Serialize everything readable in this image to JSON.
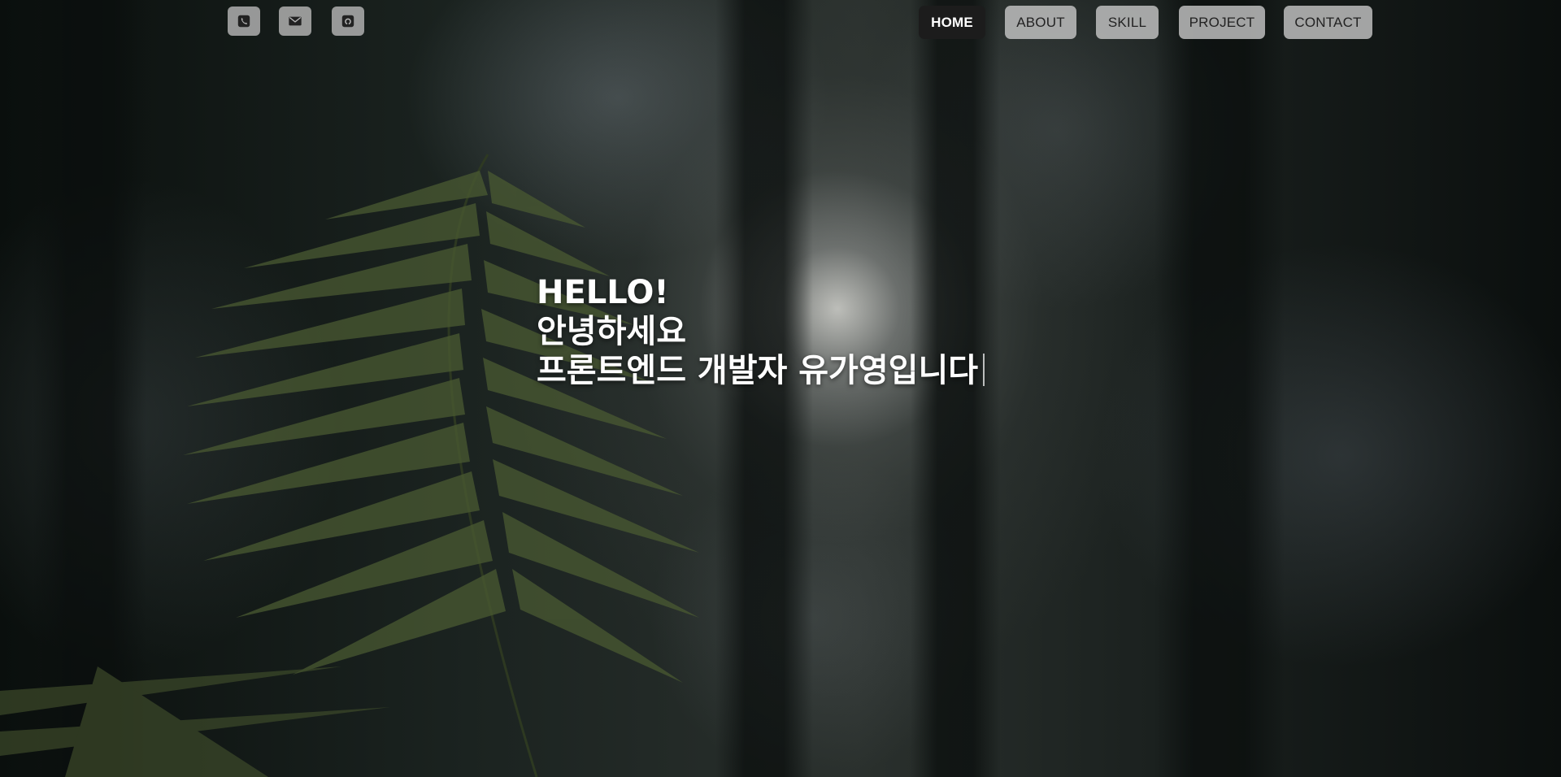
{
  "contact_icons": [
    {
      "icon": "phone-icon"
    },
    {
      "icon": "mail-icon"
    },
    {
      "icon": "github-icon"
    }
  ],
  "nav": {
    "items": [
      {
        "label": "HOME",
        "active": true
      },
      {
        "label": "ABOUT",
        "active": false
      },
      {
        "label": "SKILL",
        "active": false
      },
      {
        "label": "PROJECT",
        "active": false
      },
      {
        "label": "CONTACT",
        "active": false
      }
    ]
  },
  "hero": {
    "line1": "HELLO!",
    "line2": "안녕하세요",
    "line3": "프론트엔드 개발자 유가영입니다"
  },
  "colors": {
    "active_nav_bg": "#1c1c1c",
    "nav_bg": "#c8c8c8",
    "text": "#ffffff"
  }
}
